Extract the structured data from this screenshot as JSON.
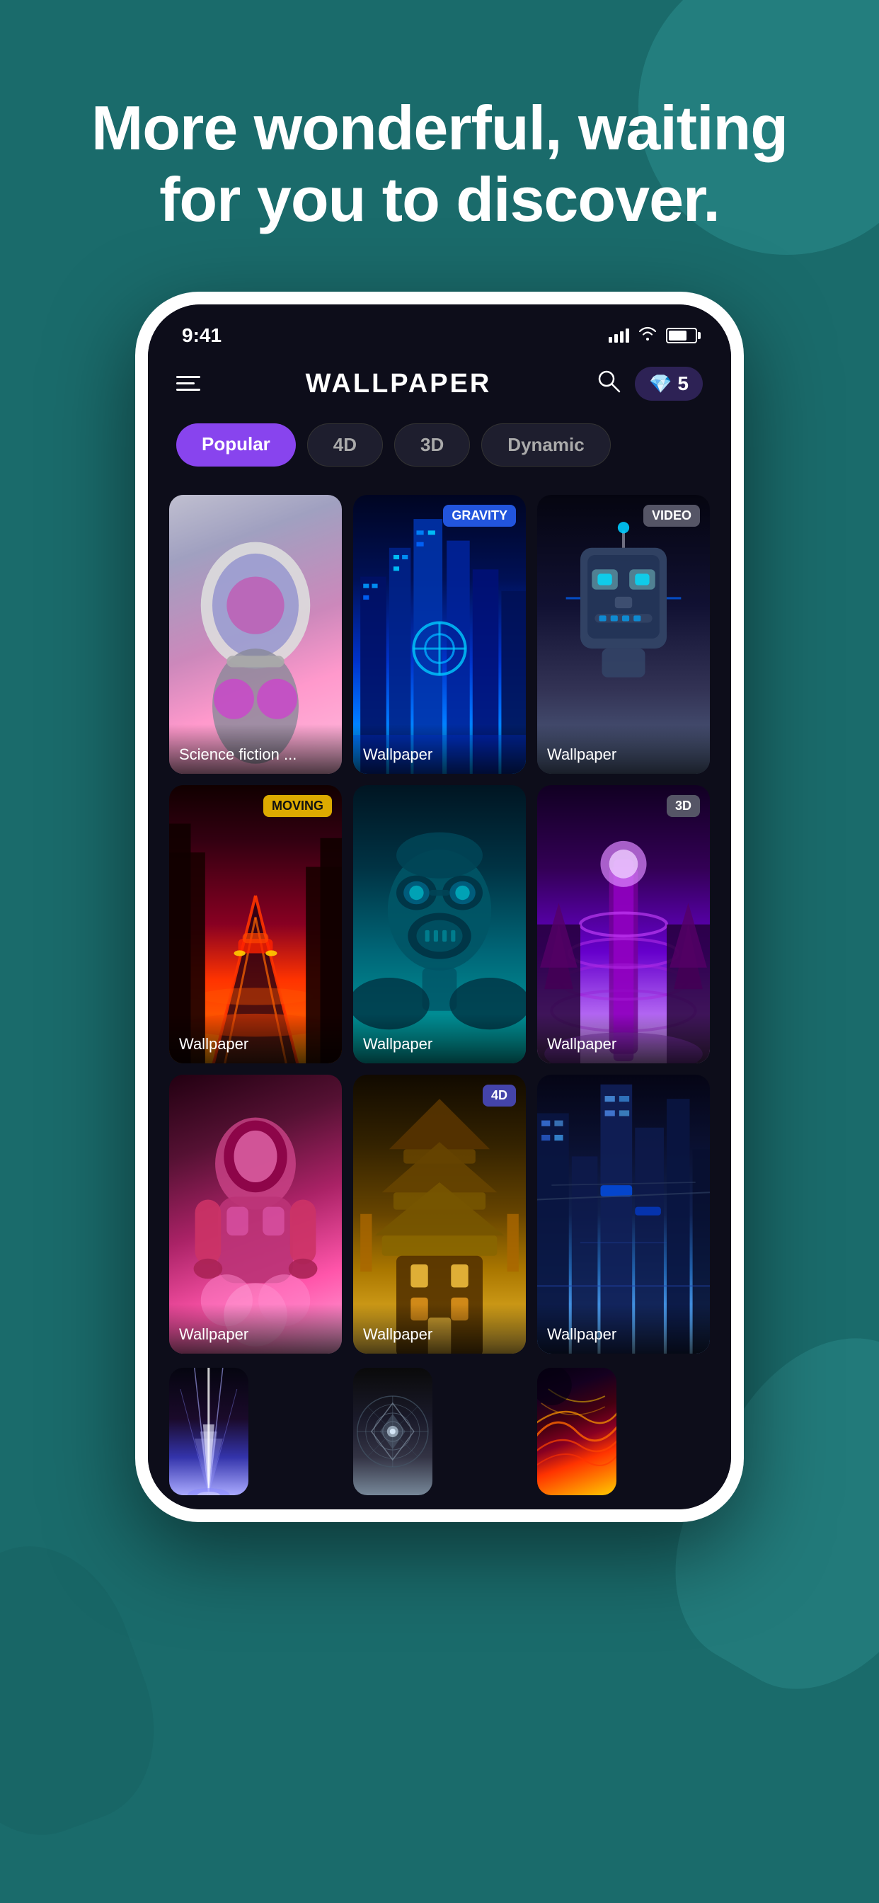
{
  "background": {
    "color": "#1a6b6b"
  },
  "headline": {
    "line1": "More wonderful, waiting",
    "line2": "for you to discover.",
    "full_text": "More wonderful, waiting for you to discover."
  },
  "status_bar": {
    "time": "9:41",
    "signal": "●●●",
    "wifi": "wifi",
    "battery": "battery"
  },
  "app_header": {
    "menu_icon": "≡",
    "title": "WALLPAPER",
    "search_icon": "search",
    "gems_count": "5",
    "gems_icon": "💎"
  },
  "tabs": [
    {
      "label": "Popular",
      "active": true
    },
    {
      "label": "4D",
      "active": false
    },
    {
      "label": "3D",
      "active": false
    },
    {
      "label": "Dynamic",
      "active": false
    }
  ],
  "wallpapers": [
    {
      "id": 1,
      "label": "Science fiction ...",
      "tag": "none",
      "color_class": "wp-1"
    },
    {
      "id": 2,
      "label": "Wallpaper",
      "tag": "GRAVITY",
      "tag_class": "tag-gravity",
      "color_class": "wp-2"
    },
    {
      "id": 3,
      "label": "Wallpaper",
      "tag": "VIDEO",
      "tag_class": "tag-video",
      "color_class": "wp-3"
    },
    {
      "id": 4,
      "label": "Wallpaper",
      "tag": "MOVING",
      "tag_class": "tag-moving",
      "color_class": "wp-4"
    },
    {
      "id": 5,
      "label": "Wallpaper",
      "tag": "none",
      "color_class": "wp-5"
    },
    {
      "id": 6,
      "label": "Wallpaper",
      "tag": "3D",
      "tag_class": "tag-3d",
      "color_class": "wp-6"
    },
    {
      "id": 7,
      "label": "Wallpaper",
      "tag": "none",
      "color_class": "wp-7"
    },
    {
      "id": 8,
      "label": "Wallpaper",
      "tag": "4D",
      "tag_class": "tag-4d",
      "color_class": "wp-8"
    },
    {
      "id": 9,
      "label": "Wallpaper",
      "tag": "none",
      "color_class": "wp-9"
    },
    {
      "id": 10,
      "label": "",
      "tag": "none",
      "color_class": "wp-10"
    },
    {
      "id": 11,
      "label": "",
      "tag": "none",
      "color_class": "wp-11"
    },
    {
      "id": 12,
      "label": "",
      "tag": "none",
      "color_class": "wp-12"
    }
  ]
}
